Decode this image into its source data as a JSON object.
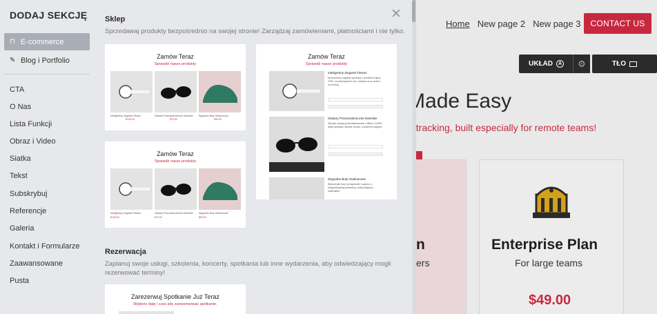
{
  "site": {
    "nav": [
      "Home",
      "New page 2",
      "New page 3"
    ],
    "contact_label": "CONTACT US",
    "ctrl_layout": "UKŁAD",
    "ctrl_layout_badge": "A",
    "ctrl_background": "TŁO",
    "hero_title": "g Made Easy",
    "hero_subtitle": "t tracking, built especially for remote teams!",
    "card1_title": "n",
    "card1_sub": "ers",
    "card2_title": "Enterprise Plan",
    "card2_sub": "For large teams",
    "card2_price": "$49.00"
  },
  "panel": {
    "title": "DODAJ SEKCJĘ",
    "categories": [
      {
        "label": "E-commerce",
        "icon": "shopping-bag-icon",
        "selected": true
      },
      {
        "label": "Blog i Portfolio",
        "icon": "edit-icon",
        "selected": false
      }
    ],
    "nav_items": [
      "CTA",
      "O Nas",
      "Lista Funkcji",
      "Obraz i Video",
      "Siatka",
      "Tekst",
      "Subskrybuj",
      "Referencje",
      "Galeria",
      "Kontakt i Formularze",
      "Zaawansowane",
      "Pusta"
    ],
    "close_glyph": "✕"
  },
  "sections": {
    "shop": {
      "heading": "Sklep",
      "description": "Sprzedawaj produkty bezpośrednio na swojej stronie! Zarządzaj zamówieniami, płatnościami i nie tylko.",
      "templates": [
        {
          "title": "Zamów Teraz",
          "subtitle": "Sprawdź nasze produkty",
          "products": [
            {
              "name": "Inteligentny Zegarek Fitness",
              "price": "$149.00"
            },
            {
              "name": "Okulary Przeciwsłoneczne Damskie",
              "price": "$79.00"
            },
            {
              "name": "Wygodne Buty Outdoorowe",
              "price": "$99.00"
            }
          ]
        },
        {
          "title": "Zamów Teraz",
          "subtitle": "Sprawdź nasze produkty",
          "products": [
            {
              "name": "Inteligentny Zegarek Fitness",
              "price": "$149.00"
            },
            {
              "name": "Okulary Przeciwsłoneczne Damskie",
              "price": "$79.00"
            },
            {
              "name": "Wygodne Buty Outdoorowe",
              "price": "$99.00"
            }
          ]
        },
        {
          "title": "Zamów Teraz",
          "subtitle": "Sprawdź nasze produkty",
          "rows": [
            {
              "name": "Inteligentny Zegarek Fitness",
              "desc": "Nowoczesny zegarek sportowy z pomiarem tętna, GPS i monitorowaniem snu. Idealny na co dzień i na trening."
            },
            {
              "name": "Okulary Przeciwsłoneczne Damskie",
              "desc": "Stylowe okulary przeciwsłoneczne z filtrem UV400, lekka oprawka, idealne na lato i codzienne wyjścia."
            },
            {
              "name": "Wygodne Buty Outdoorowe",
              "desc": "Wytrzymałe buty na wędrówki i spacery, z antypoślizgową podeszwą i oddychającym materiałem."
            }
          ]
        }
      ]
    },
    "booking": {
      "heading": "Rezerwacja",
      "description": "Zaplanuj swoje usługi, szkolenia, koncerty, spotkania lub inne wydarzenia, aby odwiedzający mogli rezerwować terminy!",
      "template_title": "Zarezerwuj Spotkanie Już Teraz",
      "template_subtitle": "Wybierz datę i czas aby zarezerwować spotkanie."
    }
  },
  "colors": {
    "accent": "#c8283f",
    "panel_bg": "#e7e8ec",
    "selected_bg": "#a9adb6"
  }
}
